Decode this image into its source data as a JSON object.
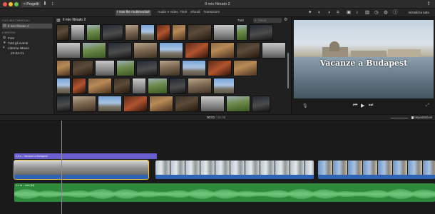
{
  "toolbar": {
    "back_label": "< Progetti",
    "window_title": "Il mio filmato 2"
  },
  "tabs": [
    {
      "label": "I miei file multimediali",
      "active": true
    },
    {
      "label": "Audio e video",
      "active": false
    },
    {
      "label": "Titoli",
      "active": false
    },
    {
      "label": "Sfondi",
      "active": false
    },
    {
      "label": "Transizioni",
      "active": false
    }
  ],
  "reset_all_label": "Inizializza tutto",
  "sidebar": {
    "section_media": "FILE MULTIMEDIALI",
    "project_item": "Il mio filmato 2",
    "section_library": "LIBRERIE",
    "items": [
      "Foto",
      "Tutti gli eventi"
    ],
    "library_name": "Libreria iMovie",
    "event_name": "23-02-21"
  },
  "browser": {
    "title": "Il mio filmato 2",
    "filter": "Tutti",
    "search_placeholder": "Cerca"
  },
  "viewer": {
    "video_title": "Vacanze a Budapest"
  },
  "timecode": {
    "current": "00:01",
    "total": "01:05"
  },
  "settings_label": "Impostazioni",
  "timeline": {
    "title_clip_label": "2,5 s – Vacanze a Budapest",
    "music_label": "1,1 m – Intel (M)"
  },
  "colors": {
    "title_bar": "#6a5fd0",
    "video_clip": "#3a5fa0",
    "music_clip": "#2d8a3a",
    "selection": "#e7c34a"
  }
}
